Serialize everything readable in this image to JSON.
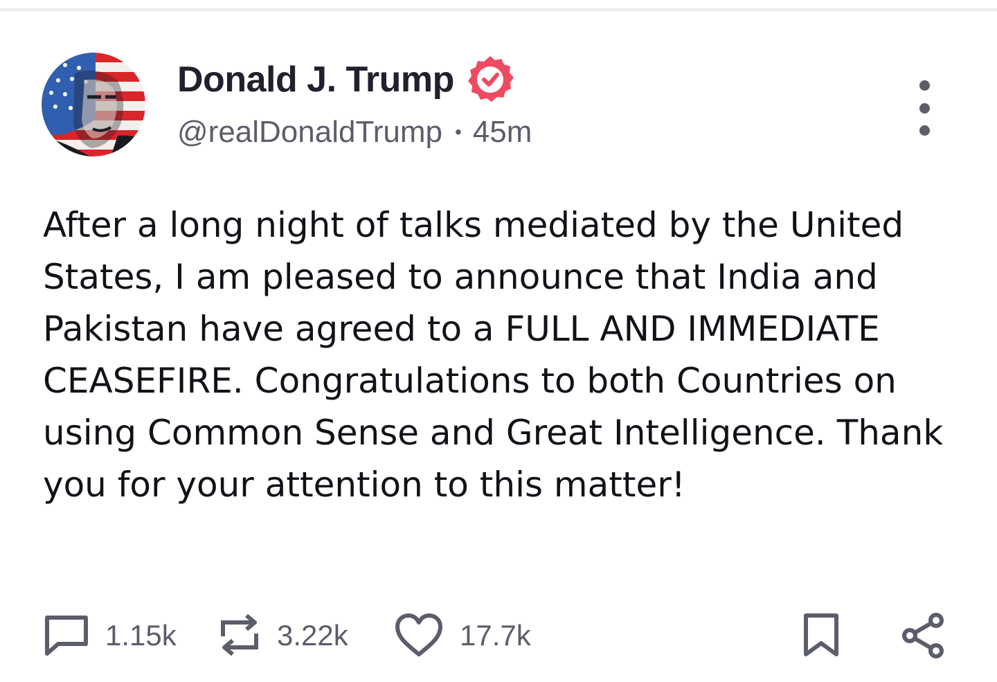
{
  "author": {
    "display_name": "Donald J. Trump",
    "handle": "@realDonaldTrump",
    "separator": "•",
    "time_ago": "45m",
    "verified": true
  },
  "post": {
    "text": "After a long night of talks mediated by the United States, I am pleased to announce that India and Pakistan have agreed to a FULL AND IMMEDIATE CEASEFIRE. Congratulations to both Countries on using Common Sense and Great Intelligence. Thank you for your attention to this matter!"
  },
  "actions": {
    "replies": "1.15k",
    "retruths": "3.22k",
    "likes": "17.7k"
  },
  "icons": {
    "verified": "verified-badge-icon",
    "more": "more-options-icon",
    "reply": "comment-icon",
    "retruth": "repost-icon",
    "like": "heart-icon",
    "bookmark": "bookmark-icon",
    "share": "share-icon"
  },
  "colors": {
    "verified_badge": "#ee4a62",
    "text_primary": "#111118",
    "text_secondary": "#5b5d6b"
  }
}
